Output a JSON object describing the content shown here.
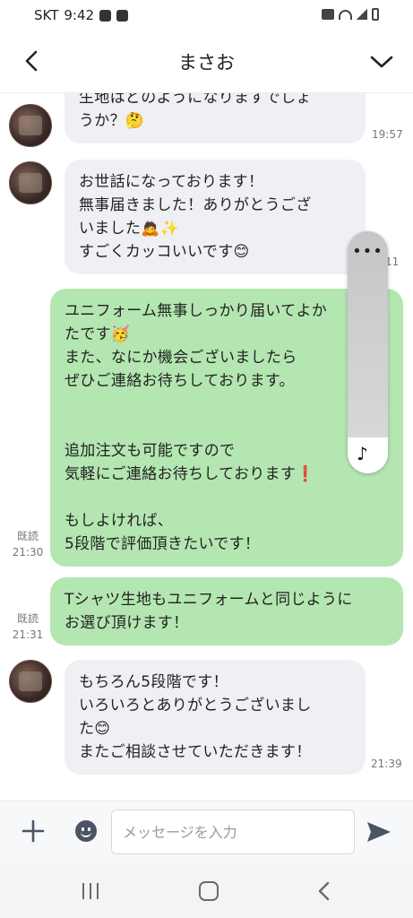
{
  "status_bar": {
    "carrier": "SKT",
    "time": "9:42"
  },
  "header": {
    "title": "まさお"
  },
  "messages": [
    {
      "side": "left",
      "text": "生地はどのようになりますでしょ\nうか？🤔",
      "time": "19:57"
    },
    {
      "side": "left",
      "text": "お世話になっております！\n無事届きました！ありがとうござ\nいました🙇✨\nすごくカッコいいです😊",
      "time": "11"
    },
    {
      "side": "right",
      "text": "ユニフォーム無事しっかり届いてよか\nたです🥳\nまた、なにか機会ございましたら\nぜひご連絡お待ちしております。\n\n\n追加注文も可能ですので\n気軽にご連絡お待ちしております❗\n\nもしよければ、\n5段階で評価頂きたいです！",
      "read": "既読",
      "time": "21:30"
    },
    {
      "side": "right",
      "text": "Tシャツ生地もユニフォームと同じように\nお選び頂けます！",
      "read": "既読",
      "time": "21:31"
    },
    {
      "side": "left",
      "text": "もちろん5段階です！\nいろいろとありがとうございまし\nた😊\nまたご相談させていただきます！",
      "time": "21:39"
    }
  ],
  "floating_panel": {
    "menu": "•••",
    "icon": "♪"
  },
  "input_bar": {
    "placeholder": "メッセージを入力"
  },
  "colors": {
    "bubble_right": "#b4e6b1",
    "bubble_left": "#eff0f3",
    "icon": "#4b5365"
  }
}
